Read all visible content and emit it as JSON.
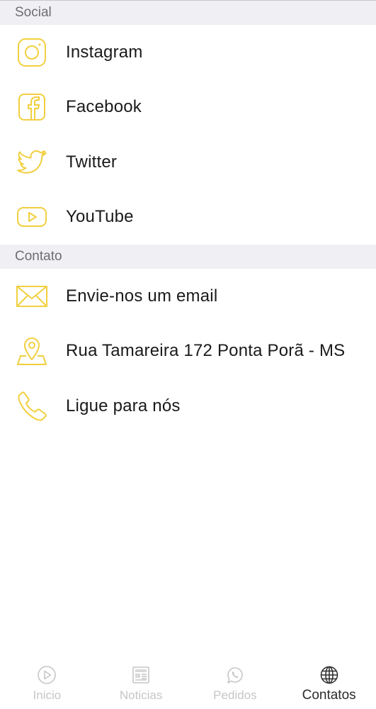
{
  "colors": {
    "accent": "#f1cf3f",
    "section_bg": "#efeff4",
    "tab_inactive": "#c6c6c6",
    "tab_active": "#2b2b2b"
  },
  "sections": {
    "social": {
      "title": "Social",
      "items": [
        {
          "label": "Instagram",
          "icon": "instagram-icon"
        },
        {
          "label": "Facebook",
          "icon": "facebook-icon"
        },
        {
          "label": "Twitter",
          "icon": "twitter-icon"
        },
        {
          "label": "YouTube",
          "icon": "youtube-icon"
        }
      ]
    },
    "contato": {
      "title": "Contato",
      "items": [
        {
          "label": "Envie-nos um email",
          "icon": "mail-icon"
        },
        {
          "label": "Rua Tamareira 172 Ponta Porã - MS",
          "icon": "map-pin-icon"
        },
        {
          "label": "Ligue para nós",
          "icon": "phone-icon"
        }
      ]
    }
  },
  "tabbar": {
    "tabs": [
      {
        "label": "Inicio",
        "icon": "play-circle-icon",
        "active": false
      },
      {
        "label": "Noticias",
        "icon": "newspaper-icon",
        "active": false
      },
      {
        "label": "Pedidos",
        "icon": "whatsapp-icon",
        "active": false
      },
      {
        "label": "Contatos",
        "icon": "globe-icon",
        "active": true
      }
    ]
  }
}
